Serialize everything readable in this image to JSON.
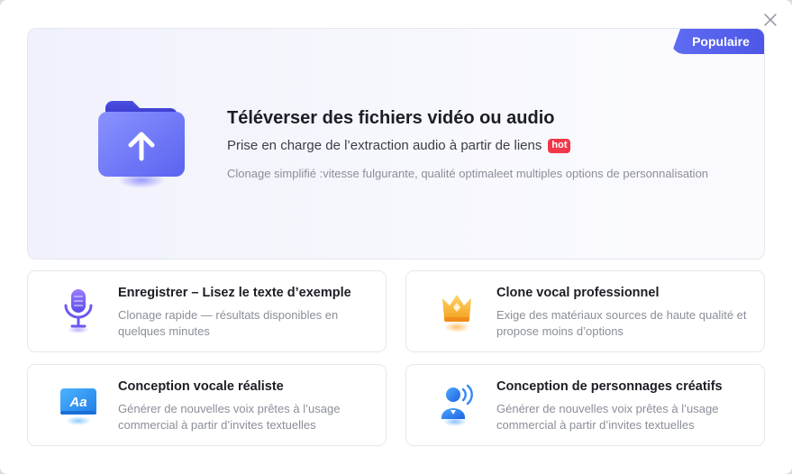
{
  "hero": {
    "badge": "Populaire",
    "title": "Téléverser des fichiers vidéo ou audio",
    "subtitle": "Prise en charge de l’extraction audio à partir de liens",
    "hot_tag": "hot",
    "description": "Clonage simplifié :vitesse fulgurante, qualité optimaleet multiples options de personnalisation",
    "icon": "upload-folder-icon"
  },
  "cards": [
    {
      "title": "Enregistrer – Lisez le texte d’exemple",
      "description": "Clonage rapide — résultats disponibles en quelques minutes",
      "icon": "microphone-icon"
    },
    {
      "title": "Clone vocal professionnel",
      "description": "Exige des matériaux sources de haute qualité et propose moins d’options",
      "icon": "crown-icon"
    },
    {
      "title": "Conception vocale réaliste",
      "description": "Générer de nouvelles voix prêtes à l’usage commercial à partir d’invites textuelles",
      "icon": "text-aa-icon"
    },
    {
      "title": "Conception de personnages créatifs",
      "description": "Générer de nouvelles voix prêtes à l’usage commercial à partir d’invites textuelles",
      "icon": "character-voice-icon"
    }
  ],
  "colors": {
    "accent": "#5a63ee",
    "hot": "#f0384a",
    "title": "#1c1d26",
    "muted": "#8b8e9a"
  }
}
